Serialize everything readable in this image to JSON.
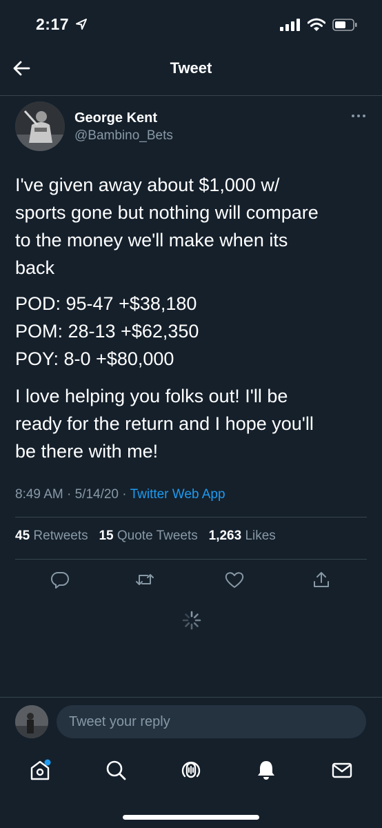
{
  "status_bar": {
    "time": "2:17"
  },
  "header": {
    "title": "Tweet"
  },
  "author": {
    "name": "George Kent",
    "handle": "@Bambino_Bets"
  },
  "tweet": {
    "paragraph1": [
      "I've given away about $1,000 w/",
      "sports gone but nothing will compare",
      "to the money we'll make when its",
      "back"
    ],
    "paragraph2": [
      "POD: 95-47 +$38,180",
      "POM: 28-13 +$62,350",
      "POY: 8-0 +$80,000"
    ],
    "paragraph3": [
      "I love helping you folks out! I'll be",
      "ready for the return and I hope you'll",
      "be there with me!"
    ],
    "time": "8:49 AM",
    "date": "5/14/20",
    "separator": "·",
    "source": "Twitter Web App"
  },
  "stats": {
    "retweets_count": "45",
    "retweets_label": "Retweets",
    "quotes_count": "15",
    "quotes_label": "Quote Tweets",
    "likes_count": "1,263",
    "likes_label": "Likes"
  },
  "reply": {
    "placeholder": "Tweet your reply"
  },
  "icons": {
    "back": "arrow-left-icon",
    "more": "more-dots-icon",
    "reply": "reply-icon",
    "retweet": "retweet-icon",
    "like": "heart-icon",
    "share": "share-icon",
    "tabs": [
      "home-icon",
      "search-icon",
      "spaces-icon",
      "notifications-icon",
      "messages-icon"
    ]
  },
  "colors": {
    "background": "#15202b",
    "secondary_text": "#8899a6",
    "link": "#1d9bf0",
    "divider": "#38444d"
  }
}
